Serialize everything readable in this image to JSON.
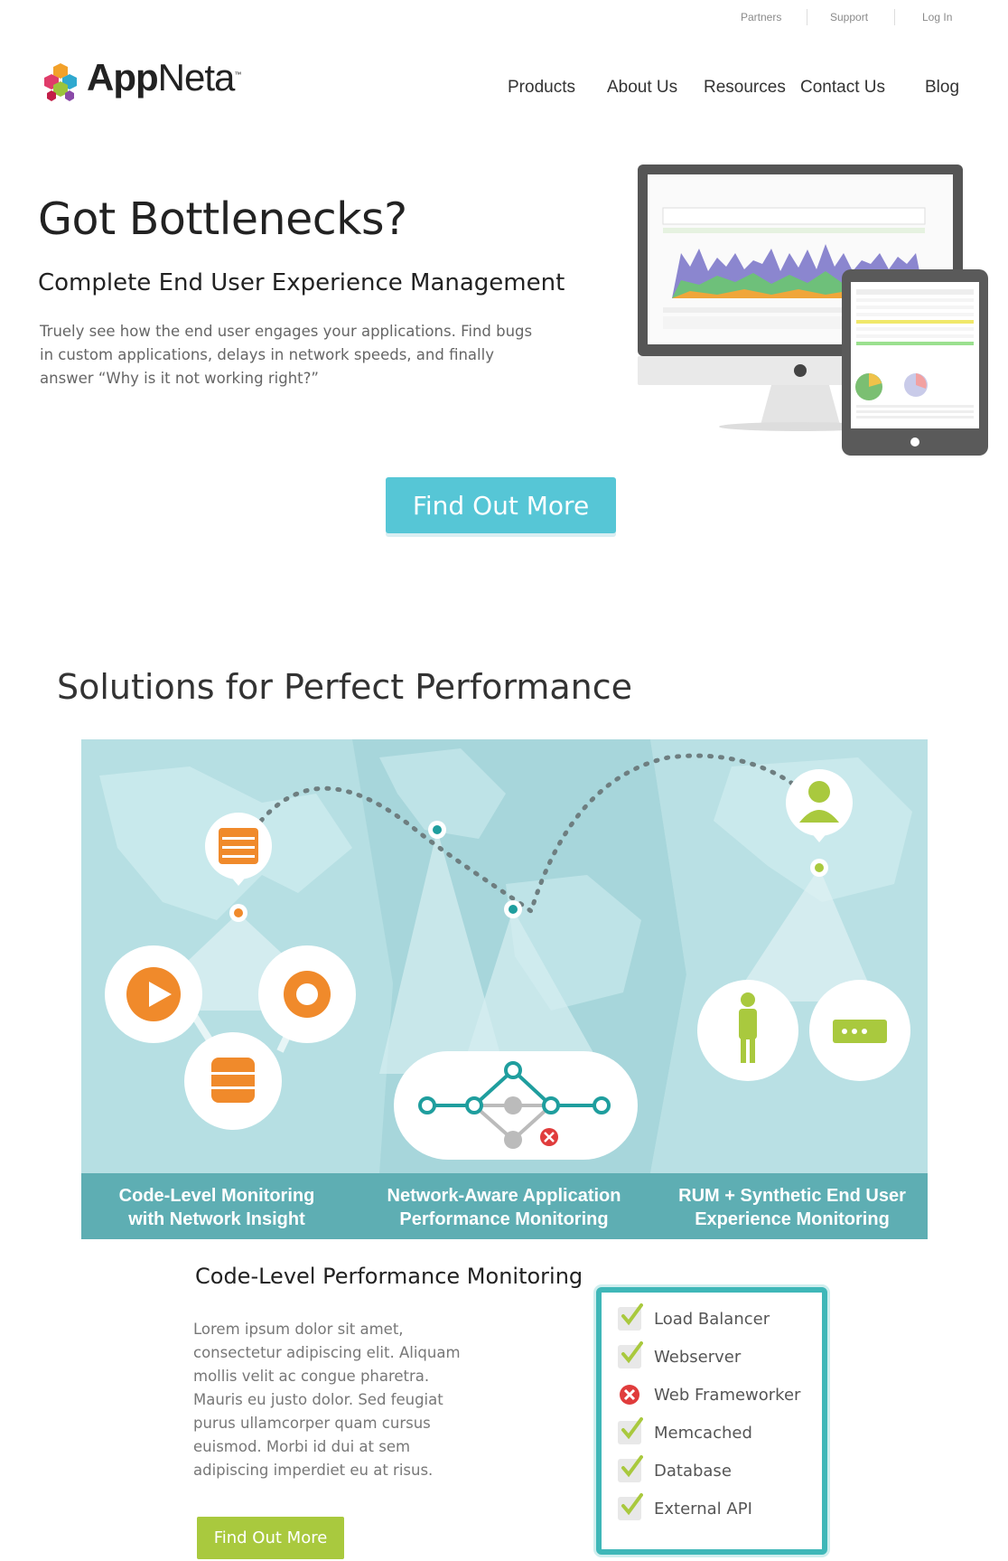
{
  "topbar": {
    "links": [
      "Partners",
      "Support",
      "Log In"
    ]
  },
  "logo": {
    "brand_bold": "App",
    "brand_light": "Neta",
    "tm": "™"
  },
  "nav": {
    "items": [
      "Products",
      "About Us",
      "Resources",
      "Contact Us",
      "Blog"
    ]
  },
  "hero": {
    "title": "Got Bottlenecks?",
    "subtitle": "Complete End User Experience Management",
    "description": "Truely see how the end user engages your applications.  Find bugs in custom applications, delays in network speeds, and finally answer “Why is it not working right?”",
    "cta": "Find Out More"
  },
  "solutions": {
    "title": "Solutions for Perfect Performance",
    "captions": [
      [
        "Code-Level Monitoring",
        "with Network Insight"
      ],
      [
        "Network-Aware Application",
        "Performance Monitoring"
      ],
      [
        "RUM + Synthetic End User",
        "Experience Monitoring"
      ]
    ]
  },
  "code_level": {
    "title": "Code-Level Performance Monitoring",
    "body": "Lorem ipsum dolor sit amet, consectetur adipiscing elit. Aliquam mollis velit ac congue pharetra. Mauris eu justo dolor. Sed feugiat purus ullamcorper quam cursus euismod. Morbi id dui at sem adipiscing imperdiet eu at risus.",
    "cta": "Find Out More",
    "checklist": [
      {
        "label": "Load Balancer",
        "status": "ok"
      },
      {
        "label": "Webserver",
        "status": "ok"
      },
      {
        "label": "Web Frameworker",
        "status": "error"
      },
      {
        "label": "Memcached",
        "status": "ok"
      },
      {
        "label": "Database",
        "status": "ok"
      },
      {
        "label": "External API",
        "status": "ok"
      }
    ]
  },
  "colors": {
    "accent_blue": "#56c6d6",
    "accent_green": "#a9c93e",
    "teal": "#3fb7b8",
    "orange": "#f08a2b",
    "error_red": "#e03c3c"
  }
}
